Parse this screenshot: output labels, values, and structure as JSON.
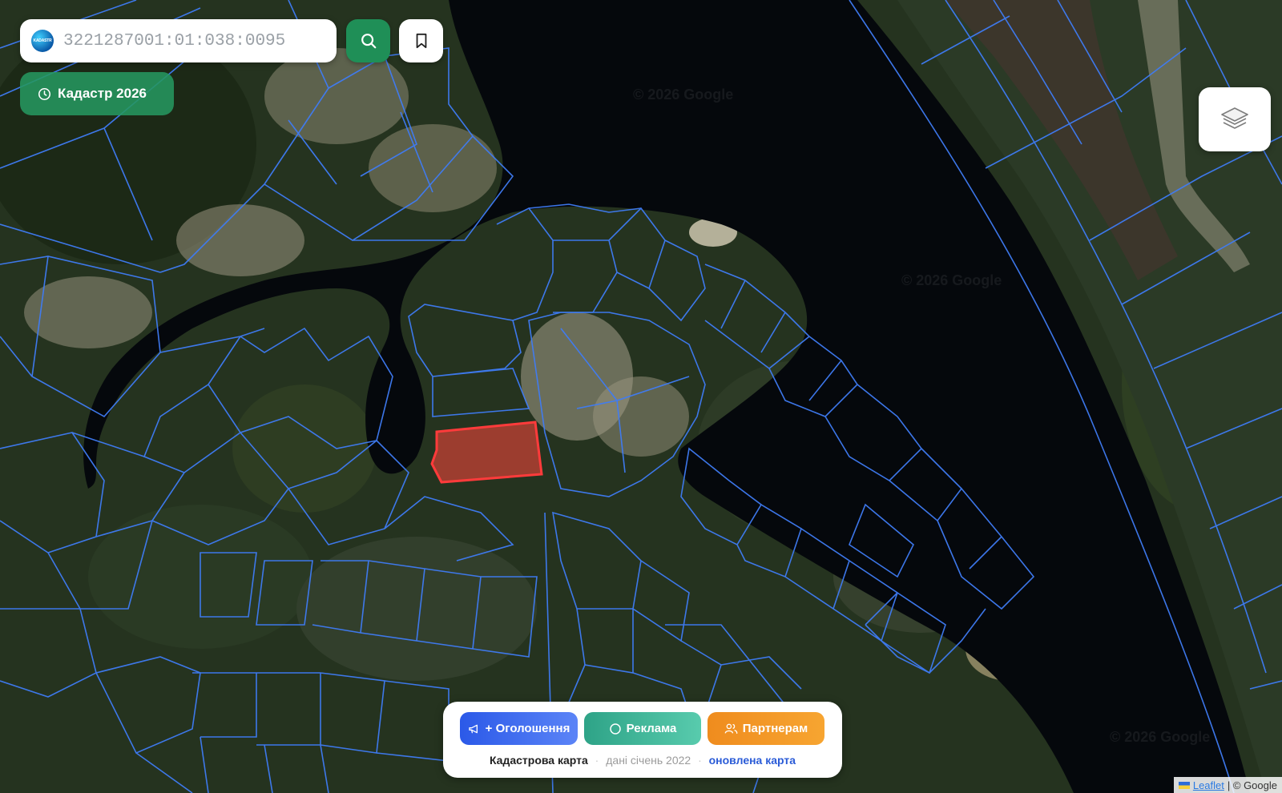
{
  "search": {
    "value": "3221287001:01:038:0095",
    "logo_text": "KADASTR"
  },
  "badge": {
    "label": "Кадастр 2026"
  },
  "watermarks": [
    "© 2026 Google",
    "© 2026 Google",
    "© 2026 Google"
  ],
  "bottom_panel": {
    "buttons": [
      {
        "label": "+ Оголошення"
      },
      {
        "label": "Реклама"
      },
      {
        "label": "Партнерам"
      }
    ],
    "footer": {
      "title": "Кадастрова карта",
      "date": "дані січень 2022",
      "link": "оновлена карта"
    }
  },
  "attribution": {
    "leaflet": "Leaflet",
    "rest": "| © Google"
  },
  "colors": {
    "parcel_stroke": "#3f7cf5",
    "selected_parcel": "#ff3b3b",
    "search_green": "#1f8f57",
    "river": "#05080c"
  },
  "icons": [
    "search-icon",
    "bookmark-icon",
    "clock-icon",
    "layers-icon",
    "megaphone-icon",
    "circle-icon",
    "users-icon"
  ]
}
